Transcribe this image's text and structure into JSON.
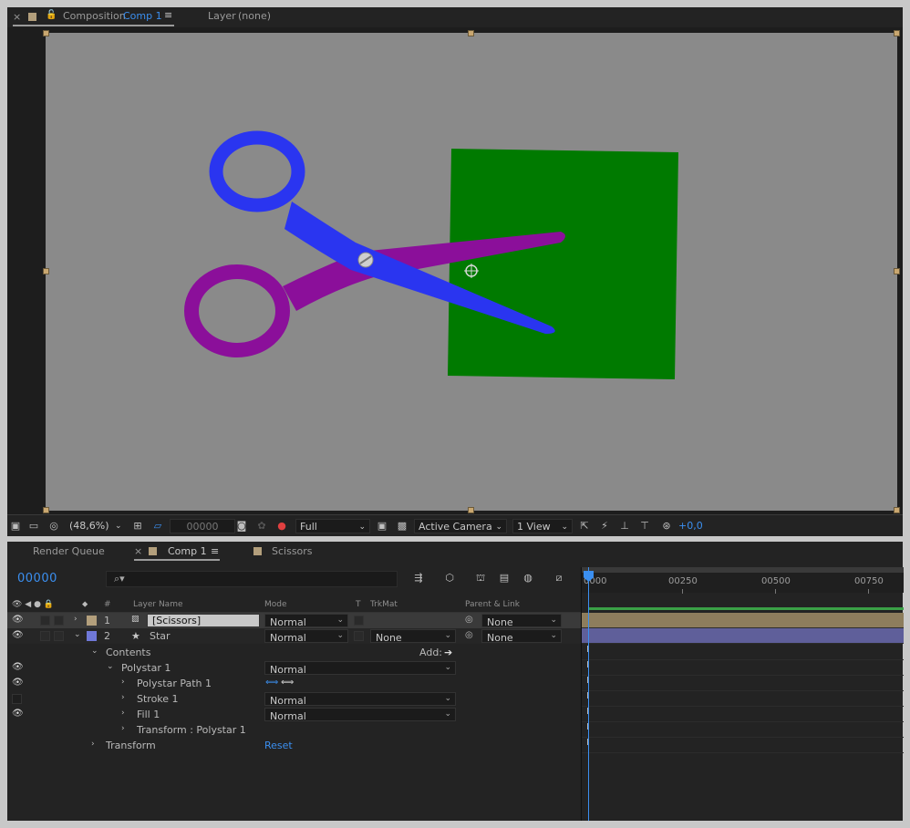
{
  "comp_panel": {
    "close": "×",
    "tab_prefix": "Composition",
    "tab_name": "Comp 1",
    "menu": "≡",
    "layer_tab": "Layer",
    "layer_value": "(none)"
  },
  "viewer_toolbar": {
    "zoom": "(48,6%)",
    "timecode": "00000",
    "resolution": "Full",
    "camera": "Active Camera",
    "views": "1 View",
    "exposure": "+0,0"
  },
  "timeline": {
    "tabs": {
      "render_queue": "Render Queue",
      "comp": "Comp 1",
      "scissors": "Scissors",
      "close": "×",
      "menu": "≡"
    },
    "timecode": "00000",
    "columns": {
      "num": "#",
      "layer_name": "Layer Name",
      "mode": "Mode",
      "t": "T",
      "trkmat": "TrkMat",
      "parent": "Parent & Link"
    },
    "layers": [
      {
        "num": "1",
        "name": "[Scissors]",
        "mode": "Normal",
        "parent": "None",
        "color": "#b39f7c"
      },
      {
        "num": "2",
        "name": "Star",
        "mode": "Normal",
        "trkmat": "None",
        "parent": "None",
        "color": "#6f78d8"
      }
    ],
    "props": {
      "contents": "Contents",
      "add": "Add:",
      "polystar": "Polystar 1",
      "polystar_mode": "Normal",
      "polystar_path": "Polystar Path 1",
      "stroke": "Stroke 1",
      "stroke_mode": "Normal",
      "fill": "Fill 1",
      "fill_mode": "Normal",
      "transform_polystar": "Transform : Polystar 1",
      "transform": "Transform",
      "reset": "Reset"
    },
    "ruler": [
      "0000",
      "00250",
      "00500",
      "00750"
    ]
  },
  "colors": {
    "accent": "#3b8ff0",
    "scissor_blue": "#2a35f0",
    "scissor_purple": "#8b0f9a",
    "green_rect": "#007a00",
    "canvas_bg": "#8a8a8a"
  }
}
